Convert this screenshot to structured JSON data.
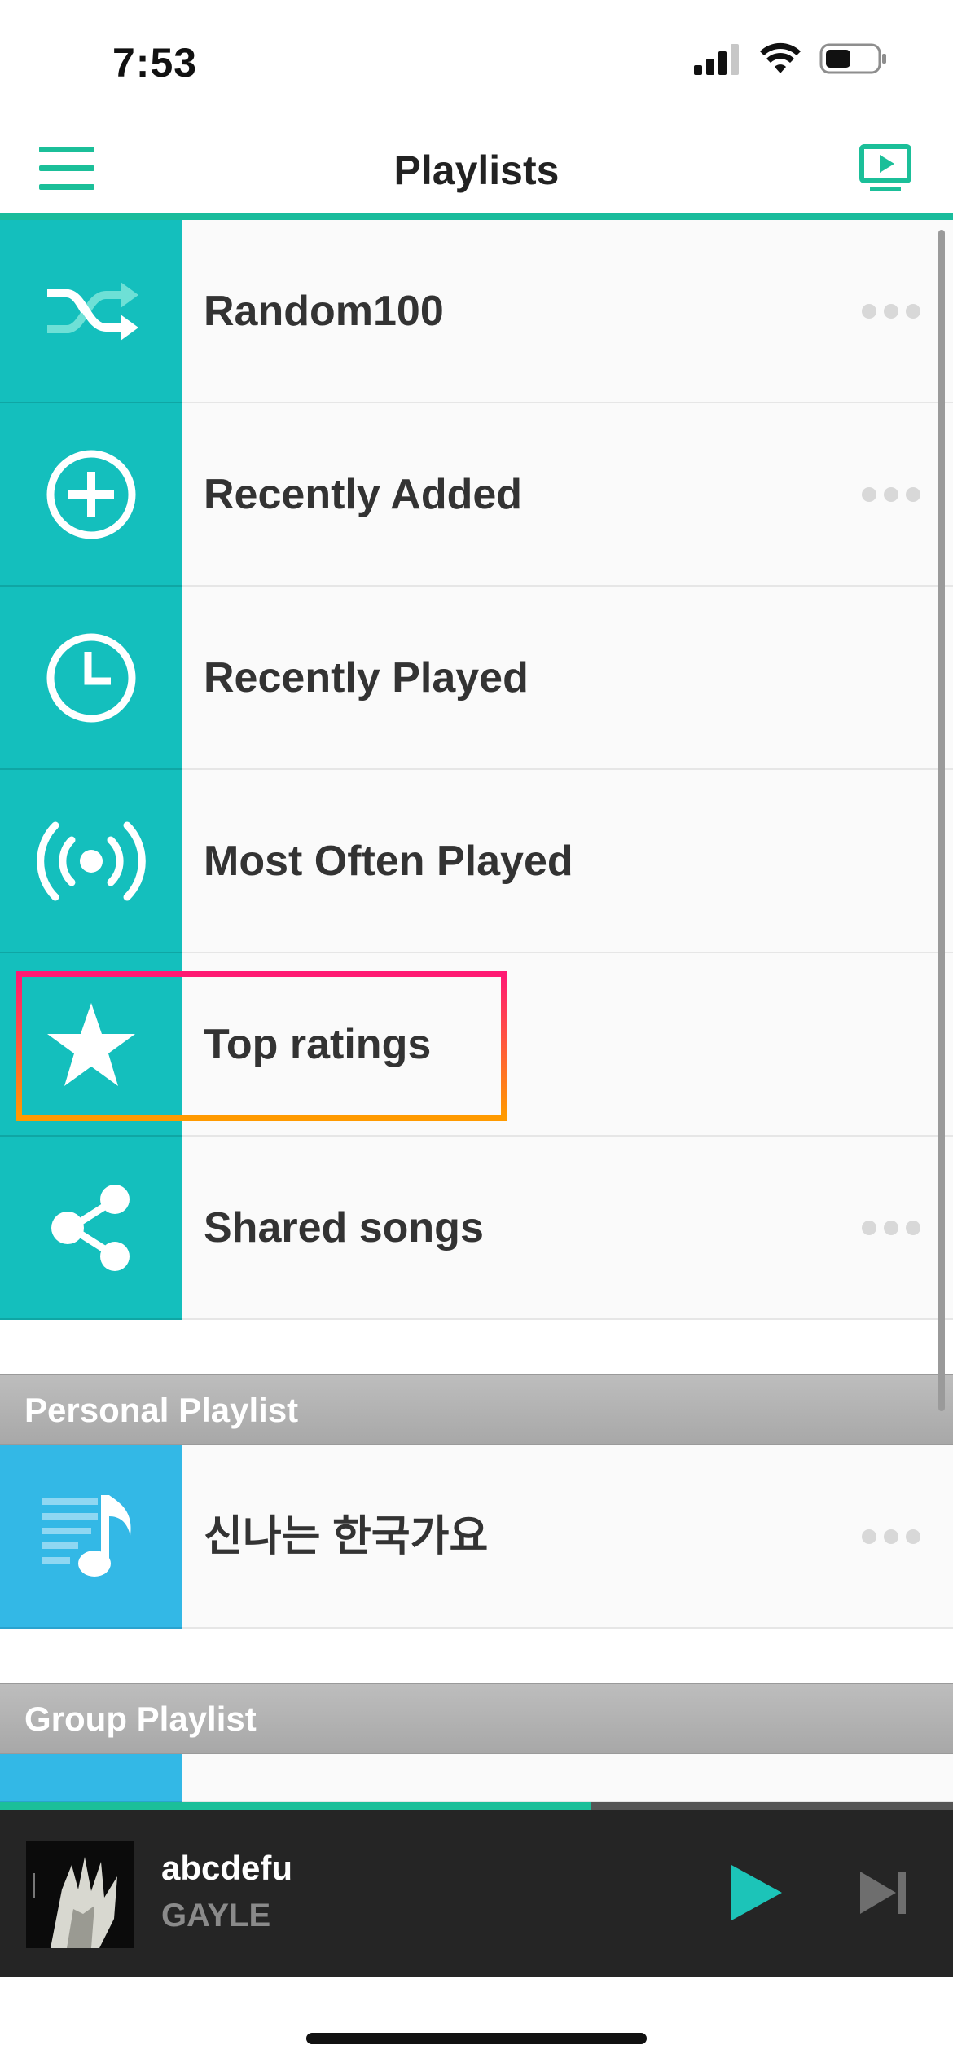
{
  "status_bar": {
    "time": "7:53"
  },
  "nav": {
    "title": "Playlists"
  },
  "playlists": [
    {
      "label": "Random100",
      "icon": "shuffle-icon"
    },
    {
      "label": "Recently Added",
      "icon": "plus-circle-icon"
    },
    {
      "label": "Recently Played",
      "icon": "clock-icon"
    },
    {
      "label": "Most Often Played",
      "icon": "broadcast-icon"
    },
    {
      "label": "Top ratings",
      "icon": "star-icon"
    },
    {
      "label": "Shared songs",
      "icon": "share-icon"
    }
  ],
  "sections": {
    "personal": "Personal Playlist",
    "group": "Group Playlist"
  },
  "personal_playlists": [
    {
      "label": "신나는 한국가요",
      "icon": "music-list-icon"
    }
  ],
  "player": {
    "title": "abcdefu",
    "artist": "GAYLE",
    "progress": 0.62
  },
  "colors": {
    "accent": "#1abc9c",
    "teal_tile": "#14bfbd",
    "blue_tile": "#33b8e6",
    "player_bg": "#252525",
    "highlight_start": "#ff1a73",
    "highlight_end": "#ff9a00"
  }
}
